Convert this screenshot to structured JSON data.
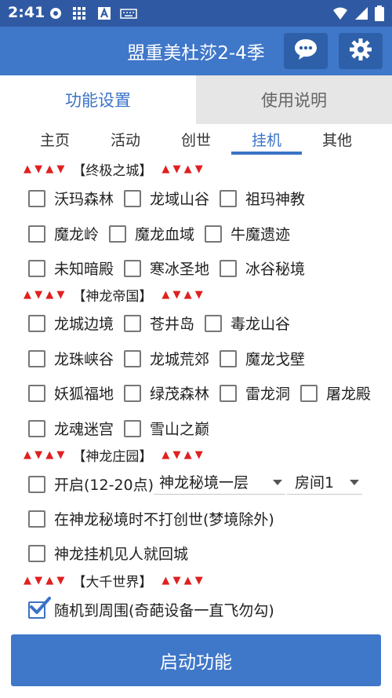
{
  "status_bar": {
    "time": "2:41",
    "icons": [
      "location-icon",
      "grid-icon",
      "a-icon",
      "keyboard-icon",
      "wifi-icon",
      "signal-icon",
      "battery-icon"
    ]
  },
  "app_bar": {
    "title": "盟重美杜莎2-4季",
    "chat_icon": "chat-icon",
    "settings_icon": "gear-icon"
  },
  "top_tabs": [
    {
      "label": "功能设置",
      "active": true
    },
    {
      "label": "使用说明",
      "active": false
    }
  ],
  "sub_tabs": [
    {
      "label": "主页",
      "active": false
    },
    {
      "label": "活动",
      "active": false
    },
    {
      "label": "创世",
      "active": false
    },
    {
      "label": "挂机",
      "active": true
    },
    {
      "label": "其他",
      "active": false
    }
  ],
  "markers": "▲ ▼ ▲ ▼",
  "sections": {
    "s1": "【终极之城】",
    "s2": "【神龙帝国】",
    "s3": "【神龙庄园】",
    "s4": "【大千世界】"
  },
  "checkboxes": {
    "wmsl": {
      "label": "沃玛森林",
      "checked": false
    },
    "lysg": {
      "label": "龙域山谷",
      "checked": false
    },
    "zmsj": {
      "label": "祖玛神教",
      "checked": false
    },
    "mll": {
      "label": "魔龙岭",
      "checked": false
    },
    "mlxy": {
      "label": "魔龙血域",
      "checked": false
    },
    "nmyj": {
      "label": "牛魔遗迹",
      "checked": false
    },
    "wzad": {
      "label": "未知暗殿",
      "checked": false
    },
    "hbsd": {
      "label": "寒冰圣地",
      "checked": false
    },
    "bgmj": {
      "label": "冰谷秘境",
      "checked": false
    },
    "lcbj": {
      "label": "龙城边境",
      "checked": false
    },
    "cjd": {
      "label": "苍井岛",
      "checked": false
    },
    "dlsg": {
      "label": "毒龙山谷",
      "checked": false
    },
    "lzxg": {
      "label": "龙珠峡谷",
      "checked": false
    },
    "lchj": {
      "label": "龙城荒郊",
      "checked": false
    },
    "mlgb": {
      "label": "魔龙戈壁",
      "checked": false
    },
    "yhfd": {
      "label": "妖狐福地",
      "checked": false
    },
    "lmsl": {
      "label": "绿茂森林",
      "checked": false
    },
    "lld": {
      "label": "雷龙洞",
      "checked": false
    },
    "tld": {
      "label": "屠龙殿",
      "checked": false
    },
    "lhmg": {
      "label": "龙魂迷宫",
      "checked": false
    },
    "xszd": {
      "label": "雪山之巅",
      "checked": false
    },
    "kq": {
      "label": "开启(12-20点)",
      "checked": false
    },
    "bdcs": {
      "label": "在神龙秘境时不打创世(梦境除外)",
      "checked": false
    },
    "jrhc": {
      "label": "神龙挂机见人就回城",
      "checked": false
    },
    "sjdzw": {
      "label": "随机到周围(奇葩设备一直飞勿勾)",
      "checked": true
    }
  },
  "selects": {
    "dungeon": "神龙秘境一层",
    "room": "房间1"
  },
  "start_button": "启动功能"
}
